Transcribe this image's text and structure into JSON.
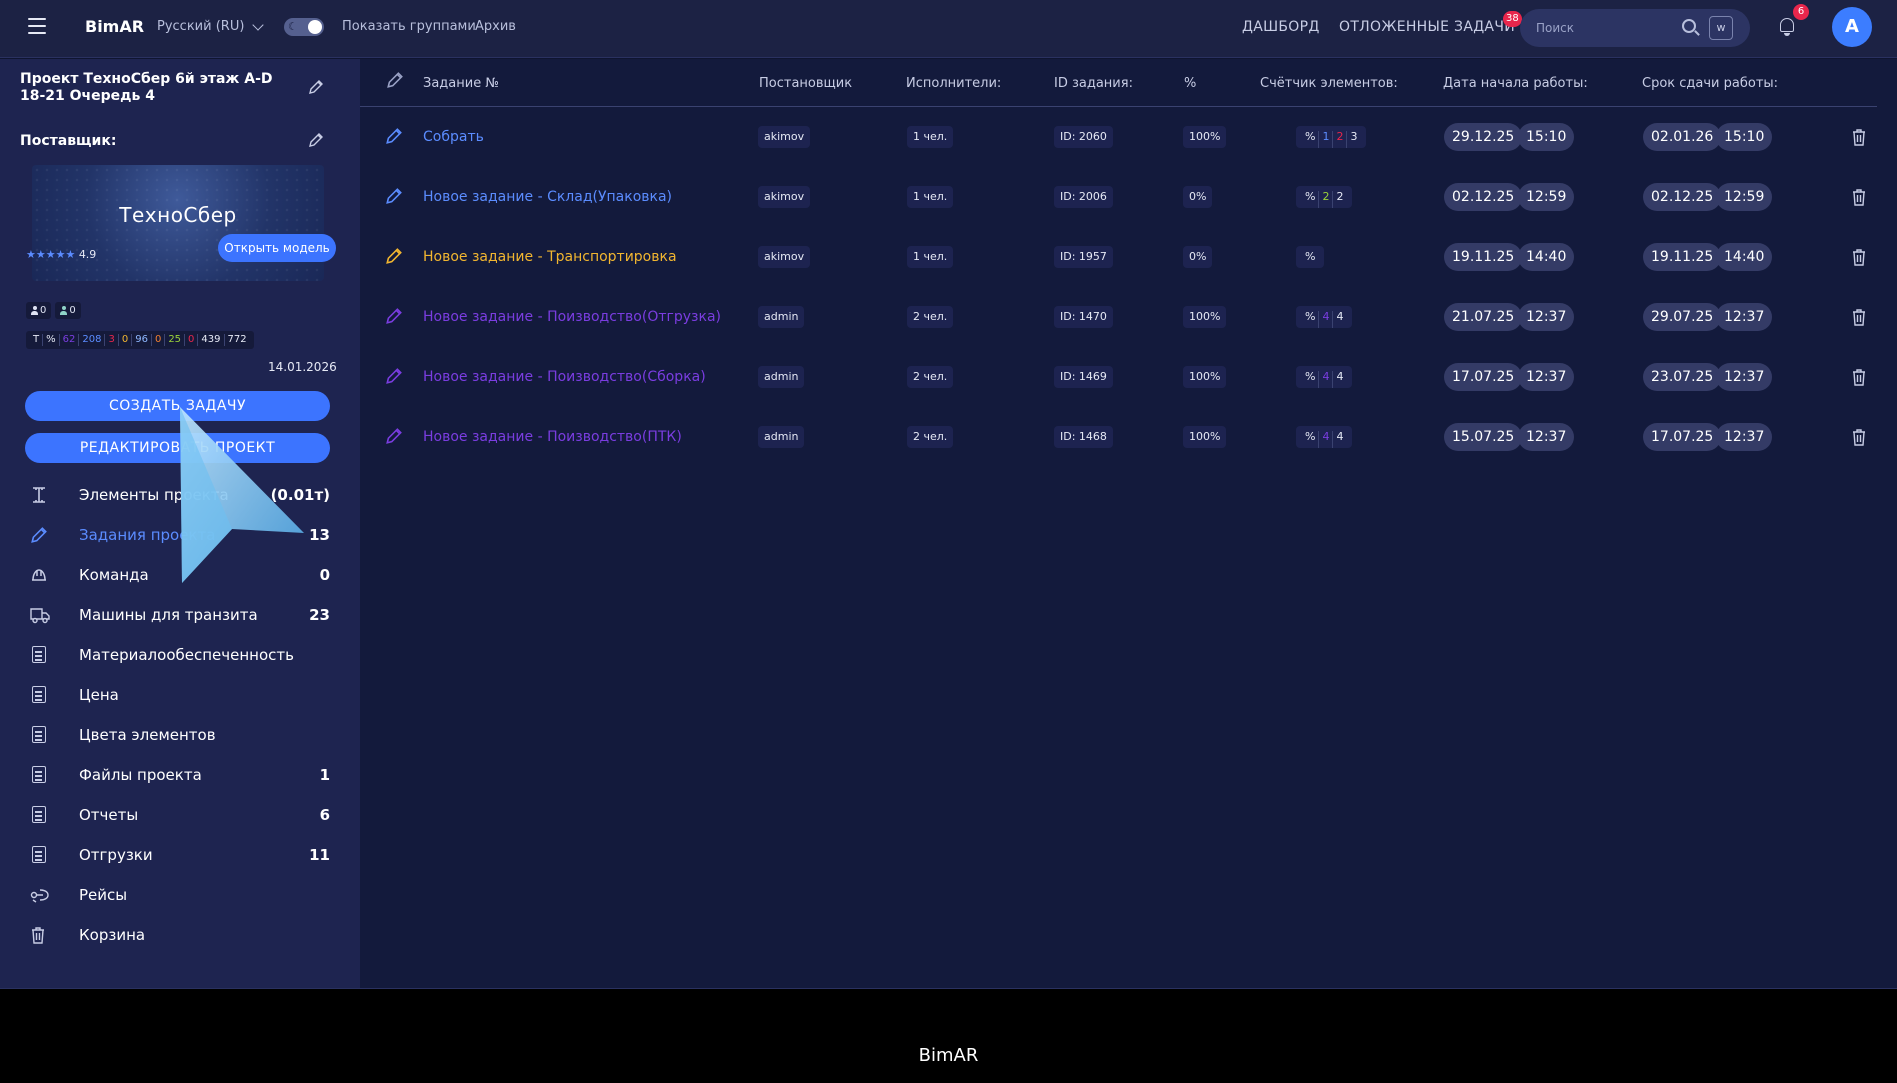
{
  "header": {
    "brand": "BimAR",
    "language": "Русский (RU)",
    "show_groups": "Показать группами",
    "archive": "Архив",
    "dashboard": "ДАШБОРД",
    "deferred_tasks": "ОТЛОЖЕННЫЕ ЗАДАЧИ",
    "deferred_count": "38",
    "search_placeholder": "Поиск",
    "w_label": "w",
    "notif_count": "6",
    "avatar_letter": "A"
  },
  "sidebar": {
    "project_title": "Проект ТехноСбер 6й этаж A-D 18-21 Очередь 4",
    "supplier_label": "Поставщик:",
    "model_name": "ТехноСбер",
    "rating_stars": "★★★★★",
    "rating_value": "4.9",
    "open_model": "Открыть модель",
    "people": [
      "0",
      "0"
    ],
    "stats": [
      {
        "text": "T",
        "color": "#e6e9f5"
      },
      {
        "text": "%",
        "color": "#e6e9f5"
      },
      {
        "text": "62",
        "color": "#7a3de0"
      },
      {
        "text": "208",
        "color": "#5b8cff"
      },
      {
        "text": "3",
        "color": "#e8264c"
      },
      {
        "text": "0",
        "color": "#f2b630"
      },
      {
        "text": "96",
        "color": "#8fb8ff"
      },
      {
        "text": "0",
        "color": "#f27f30"
      },
      {
        "text": "25",
        "color": "#9ad23a"
      },
      {
        "text": "0",
        "color": "#e8264c"
      },
      {
        "text": "439",
        "color": "#e6e9f5"
      },
      {
        "text": "772",
        "color": "#e6e9f5"
      }
    ],
    "date": "14.01.2026",
    "create_task": "СОЗДАТЬ ЗАДАЧУ",
    "edit_project": "РЕДАКТИРОВАТЬ ПРОЕКТ",
    "menu": [
      {
        "label": "Элементы проекта",
        "count": "(0.01т)",
        "icon": "beam-icon"
      },
      {
        "label": "Задания проекта",
        "count": "13",
        "icon": "pencil-icon",
        "active": true
      },
      {
        "label": "Команда",
        "count": "0",
        "icon": "helmet-icon"
      },
      {
        "label": "Машины для транзита",
        "count": "23",
        "icon": "truck-icon"
      },
      {
        "label": "Материалообеспеченность",
        "count": "",
        "icon": "document-icon"
      },
      {
        "label": "Цена",
        "count": "",
        "icon": "document-icon"
      },
      {
        "label": "Цвета элементов",
        "count": "",
        "icon": "document-icon"
      },
      {
        "label": "Файлы проекта",
        "count": "1",
        "icon": "document-icon"
      },
      {
        "label": "Отчеты",
        "count": "6",
        "icon": "document-icon"
      },
      {
        "label": "Отгрузки",
        "count": "11",
        "icon": "document-icon"
      },
      {
        "label": "Рейсы",
        "count": "",
        "icon": "route-icon"
      },
      {
        "label": "Корзина",
        "count": "",
        "icon": "trash-icon"
      }
    ]
  },
  "table": {
    "headers": [
      "Задание №",
      "Постановщик",
      "Исполнители:",
      "ID задания:",
      "%",
      "Счётчик элементов:",
      "Дата начала работы:",
      "Срок сдачи работы:"
    ],
    "rows": [
      {
        "name": "Собрать",
        "color": "#5b8cff",
        "author": "akimov",
        "executors": "1 чел.",
        "id": "ID: 2060",
        "pct": "100%",
        "counter": [
          {
            "t": "%",
            "c": "#e6e9f5"
          },
          {
            "t": "1",
            "c": "#5b8cff"
          },
          {
            "t": "2",
            "c": "#e8264c"
          },
          {
            "t": "3",
            "c": "#e6e9f5"
          }
        ],
        "start_date": "29.12.25",
        "start_time": "15:10",
        "due_date": "02.01.26",
        "due_time": "15:10"
      },
      {
        "name": "Новое задание - Склад(Упаковка)",
        "color": "#5b8cff",
        "author": "akimov",
        "executors": "1 чел.",
        "id": "ID: 2006",
        "pct": "0%",
        "counter": [
          {
            "t": "%",
            "c": "#e6e9f5"
          },
          {
            "t": "2",
            "c": "#9ad23a"
          },
          {
            "t": "2",
            "c": "#e6e9f5"
          }
        ],
        "start_date": "02.12.25",
        "start_time": "12:59",
        "due_date": "02.12.25",
        "due_time": "12:59"
      },
      {
        "name": "Новое задание - Транспортировка",
        "color": "#f2b630",
        "author": "akimov",
        "executors": "1 чел.",
        "id": "ID: 1957",
        "pct": "0%",
        "counter": [
          {
            "t": "%",
            "c": "#e6e9f5"
          }
        ],
        "start_date": "19.11.25",
        "start_time": "14:40",
        "due_date": "19.11.25",
        "due_time": "14:40"
      },
      {
        "name": "Новое задание - Поизводство(Отгрузка)",
        "color": "#7a3de0",
        "author": "admin",
        "executors": "2 чел.",
        "id": "ID: 1470",
        "pct": "100%",
        "counter": [
          {
            "t": "%",
            "c": "#e6e9f5"
          },
          {
            "t": "4",
            "c": "#7a3de0"
          },
          {
            "t": "4",
            "c": "#e6e9f5"
          }
        ],
        "start_date": "21.07.25",
        "start_time": "12:37",
        "due_date": "29.07.25",
        "due_time": "12:37"
      },
      {
        "name": "Новое задание - Поизводство(Сборка)",
        "color": "#7a3de0",
        "author": "admin",
        "executors": "2 чел.",
        "id": "ID: 1469",
        "pct": "100%",
        "counter": [
          {
            "t": "%",
            "c": "#e6e9f5"
          },
          {
            "t": "4",
            "c": "#7a3de0"
          },
          {
            "t": "4",
            "c": "#e6e9f5"
          }
        ],
        "start_date": "17.07.25",
        "start_time": "12:37",
        "due_date": "23.07.25",
        "due_time": "12:37"
      },
      {
        "name": "Новое задание - Поизводство(ПТК)",
        "color": "#7a3de0",
        "author": "admin",
        "executors": "2 чел.",
        "id": "ID: 1468",
        "pct": "100%",
        "counter": [
          {
            "t": "%",
            "c": "#e6e9f5"
          },
          {
            "t": "4",
            "c": "#7a3de0"
          },
          {
            "t": "4",
            "c": "#e6e9f5"
          }
        ],
        "start_date": "15.07.25",
        "start_time": "12:37",
        "due_date": "17.07.25",
        "due_time": "12:37"
      }
    ]
  },
  "footer": {
    "text": "BimAR"
  }
}
